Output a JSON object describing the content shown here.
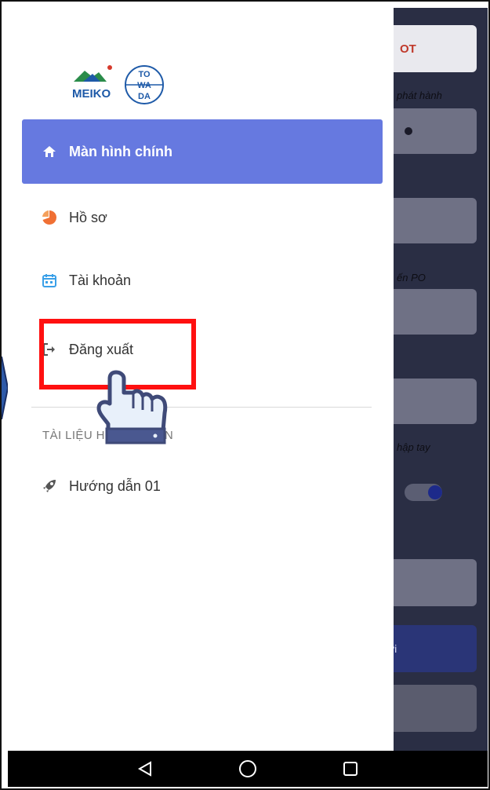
{
  "background": {
    "title_fragment": "OT",
    "label_1": "phát hành",
    "label_2": "ến PO",
    "label_3": "hập tay",
    "button_fragment": "ới"
  },
  "drawer": {
    "logo": {
      "brand_left": "MEIKO",
      "brand_right_lines": [
        "TO",
        "WA",
        "DA"
      ]
    },
    "menu": [
      {
        "label": "Màn hình chính",
        "icon": "home-icon",
        "active": true
      },
      {
        "label": "Hồ sơ",
        "icon": "pie-chart-icon",
        "active": false
      },
      {
        "label": "Tài khoản",
        "icon": "calendar-icon",
        "active": false
      },
      {
        "label": "Đăng xuất",
        "icon": "logout-icon",
        "active": false
      }
    ],
    "section_title": "TÀI LIỆU HƯỚNG DẪN",
    "guides": [
      {
        "label": "Hướng dẫn 01",
        "icon": "rocket-icon"
      }
    ]
  },
  "colors": {
    "active_bg": "#6679e0",
    "highlight": "#ff1010",
    "home_icon": "#ffffff",
    "pie_icon": "#f07034",
    "calendar_icon": "#3aa0e8",
    "logout_icon": "#555555",
    "rocket_icon": "#555555"
  }
}
